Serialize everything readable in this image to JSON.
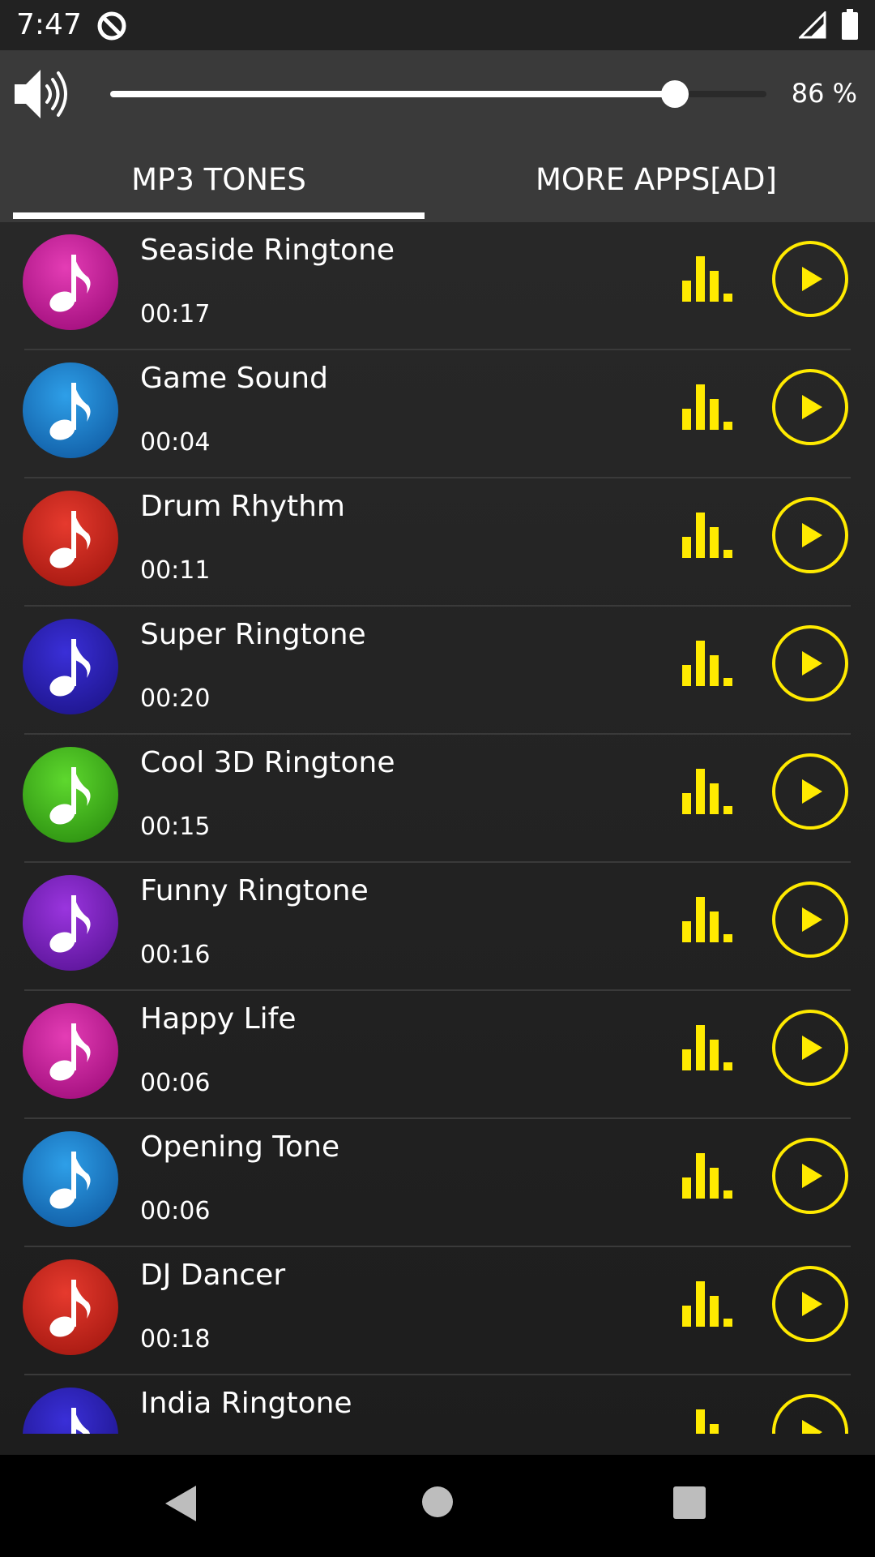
{
  "status_bar": {
    "time": "7:47",
    "icons": [
      "do-not-disturb-icon",
      "signal-icon",
      "battery-icon"
    ]
  },
  "volume": {
    "level": 0.86,
    "percent_label": "86 %",
    "icon": "speaker-icon"
  },
  "tabs": [
    {
      "label": "MP3 TONES",
      "selected": true
    },
    {
      "label": "MORE APPS[AD]",
      "selected": false
    }
  ],
  "tones": [
    {
      "name": "Seaside Ringtone",
      "duration": "00:17",
      "color": "#e43db5",
      "shade": "#a4107f"
    },
    {
      "name": "Game Sound",
      "duration": "00:04",
      "color": "#2e9fe8",
      "shade": "#1260a8"
    },
    {
      "name": "Drum Rhythm",
      "duration": "00:11",
      "color": "#e63a2e",
      "shade": "#a81a12"
    },
    {
      "name": "Super Ringtone",
      "duration": "00:20",
      "color": "#3a2fd8",
      "shade": "#1f168f"
    },
    {
      "name": "Cool 3D Ringtone",
      "duration": "00:15",
      "color": "#5ed82e",
      "shade": "#2f9412"
    },
    {
      "name": "Funny Ringtone",
      "duration": "00:16",
      "color": "#9a35de",
      "shade": "#5e169c"
    },
    {
      "name": "Happy Life",
      "duration": "00:06",
      "color": "#e43db5",
      "shade": "#a4107f"
    },
    {
      "name": "Opening Tone",
      "duration": "00:06",
      "color": "#2e9fe8",
      "shade": "#1260a8"
    },
    {
      "name": "DJ Dancer",
      "duration": "00:18",
      "color": "#e63a2e",
      "shade": "#a81a12"
    },
    {
      "name": "India Ringtone",
      "duration": "",
      "color": "#3a2fd8",
      "shade": "#1f168f"
    }
  ],
  "colors": {
    "accent": "#ffea00",
    "background": "#202020",
    "header": "#3a3a3a"
  },
  "nav_bar": {
    "icons": [
      "back-icon",
      "home-icon",
      "recents-icon"
    ]
  }
}
